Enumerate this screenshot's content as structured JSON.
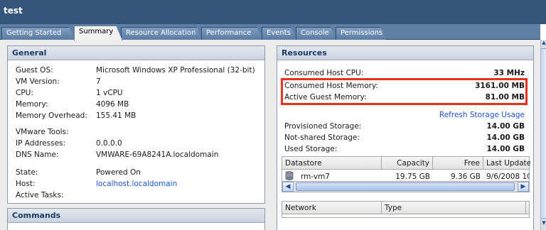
{
  "window": {
    "title": "test"
  },
  "tabs": [
    {
      "label": "Getting Started"
    },
    {
      "label": "Summary",
      "active": true
    },
    {
      "label": "Resource Allocation"
    },
    {
      "label": "Performance"
    },
    {
      "label": "Events"
    },
    {
      "label": "Console"
    },
    {
      "label": "Permissions"
    }
  ],
  "general": {
    "title": "General",
    "fields": [
      {
        "label": "Guest OS:",
        "value": "Microsoft Windows XP Professional (32-bit)"
      },
      {
        "label": "VM Version:",
        "value": "7"
      },
      {
        "label": "CPU:",
        "value": "1 vCPU"
      },
      {
        "label": "Memory:",
        "value": "4096 MB"
      },
      {
        "label": "Memory Overhead:",
        "value": "155.41 MB"
      },
      {
        "label": "VMware Tools:",
        "value": ""
      },
      {
        "label": "IP Addresses:",
        "value": "0.0.0.0"
      },
      {
        "label": "DNS Name:",
        "value": "VMWARE-69A8241A.localdomain"
      },
      {
        "label": "State:",
        "value": "Powered On"
      },
      {
        "label": "Host:",
        "value": "localhost.localdomain"
      },
      {
        "label": "Active Tasks:",
        "value": ""
      }
    ]
  },
  "commands": {
    "title": "Commands"
  },
  "resources": {
    "title": "Resources",
    "consumed_cpu": {
      "label": "Consumed Host CPU:",
      "value": "33 MHz"
    },
    "consumed_memory": {
      "label": "Consumed Host Memory:",
      "value": "3161.00 MB"
    },
    "active_memory": {
      "label": "Active Guest Memory:",
      "value": "81.00 MB"
    },
    "refresh_link": "Refresh Storage Usage",
    "provisioned": {
      "label": "Provisioned Storage:",
      "value": "14.00 GB"
    },
    "not_shared": {
      "label": "Not-shared Storage:",
      "value": "14.00 GB"
    },
    "used": {
      "label": "Used Storage:",
      "value": "14.00 GB"
    },
    "datastore_table": {
      "headers": [
        "Datastore",
        "Capacity",
        "Free",
        "Last Update"
      ],
      "rows": [
        {
          "name": "rm-vm7",
          "capacity": "19.75 GB",
          "free": "9.36 GB",
          "last_update": "9/6/2008 10"
        }
      ]
    },
    "network_table": {
      "headers": [
        "Network",
        "Type"
      ]
    }
  },
  "colors": {
    "title_bar": "#34567d",
    "tab_bar": "#5e7fa6",
    "highlight": "#e8321e",
    "link": "#1f55c9"
  }
}
